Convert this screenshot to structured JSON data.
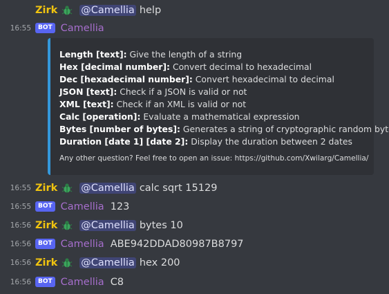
{
  "messages": [
    {
      "time": "",
      "author": "Zirk",
      "emoji": "bug-icon",
      "mention": "@Camellia",
      "text": "help"
    },
    {
      "time": "16:55",
      "bot_tag": "BOT",
      "author": "Camellia"
    },
    {
      "time": "16:55",
      "author": "Zirk",
      "emoji": "bug-icon",
      "mention": "@Camellia",
      "text": "calc sqrt 15129"
    },
    {
      "time": "16:55",
      "bot_tag": "BOT",
      "author": "Camellia",
      "text": "123"
    },
    {
      "time": "16:56",
      "author": "Zirk",
      "emoji": "bug-icon",
      "mention": "@Camellia",
      "text": "bytes 10"
    },
    {
      "time": "16:56",
      "bot_tag": "BOT",
      "author": "Camellia",
      "text": "ABE942DDAD80987B8797"
    },
    {
      "time": "16:56",
      "author": "Zirk",
      "emoji": "bug-icon",
      "mention": "@Camellia",
      "text": "hex 200"
    },
    {
      "time": "16:56",
      "bot_tag": "BOT",
      "author": "Camellia",
      "text": "C8"
    }
  ],
  "embed": {
    "lines": [
      {
        "cmd": "Length [text]:",
        "desc": " Give the length of a string"
      },
      {
        "cmd": "Hex [decimal number]:",
        "desc": " Convert decimal to hexadecimal"
      },
      {
        "cmd": "Dec [hexadecimal number]:",
        "desc": " Convert hexadecimal to decimal"
      },
      {
        "cmd": "JSON [text]:",
        "desc": " Check if a JSON is valid or not"
      },
      {
        "cmd": "XML [text]:",
        "desc": " Check if an XML is valid or not"
      },
      {
        "cmd": "Calc [operation]:",
        "desc": " Evaluate a mathematical expression"
      },
      {
        "cmd": "Bytes [number of bytes]:",
        "desc": " Generates a string of cryptographic random bytes"
      },
      {
        "cmd": "Duration [date 1] [date 2]:",
        "desc": " Display the duration between 2 dates"
      }
    ],
    "footer": "Any other question? Feel free to open an issue: https://github.com/Xwilarg/Camellia/",
    "border_color": "#3498db"
  },
  "colors": {
    "background": "#36393f",
    "user_name": "#f1c40f",
    "bot_name": "#a66ecc",
    "bot_tag": "#5865f2",
    "emoji": "#3ba55c"
  }
}
